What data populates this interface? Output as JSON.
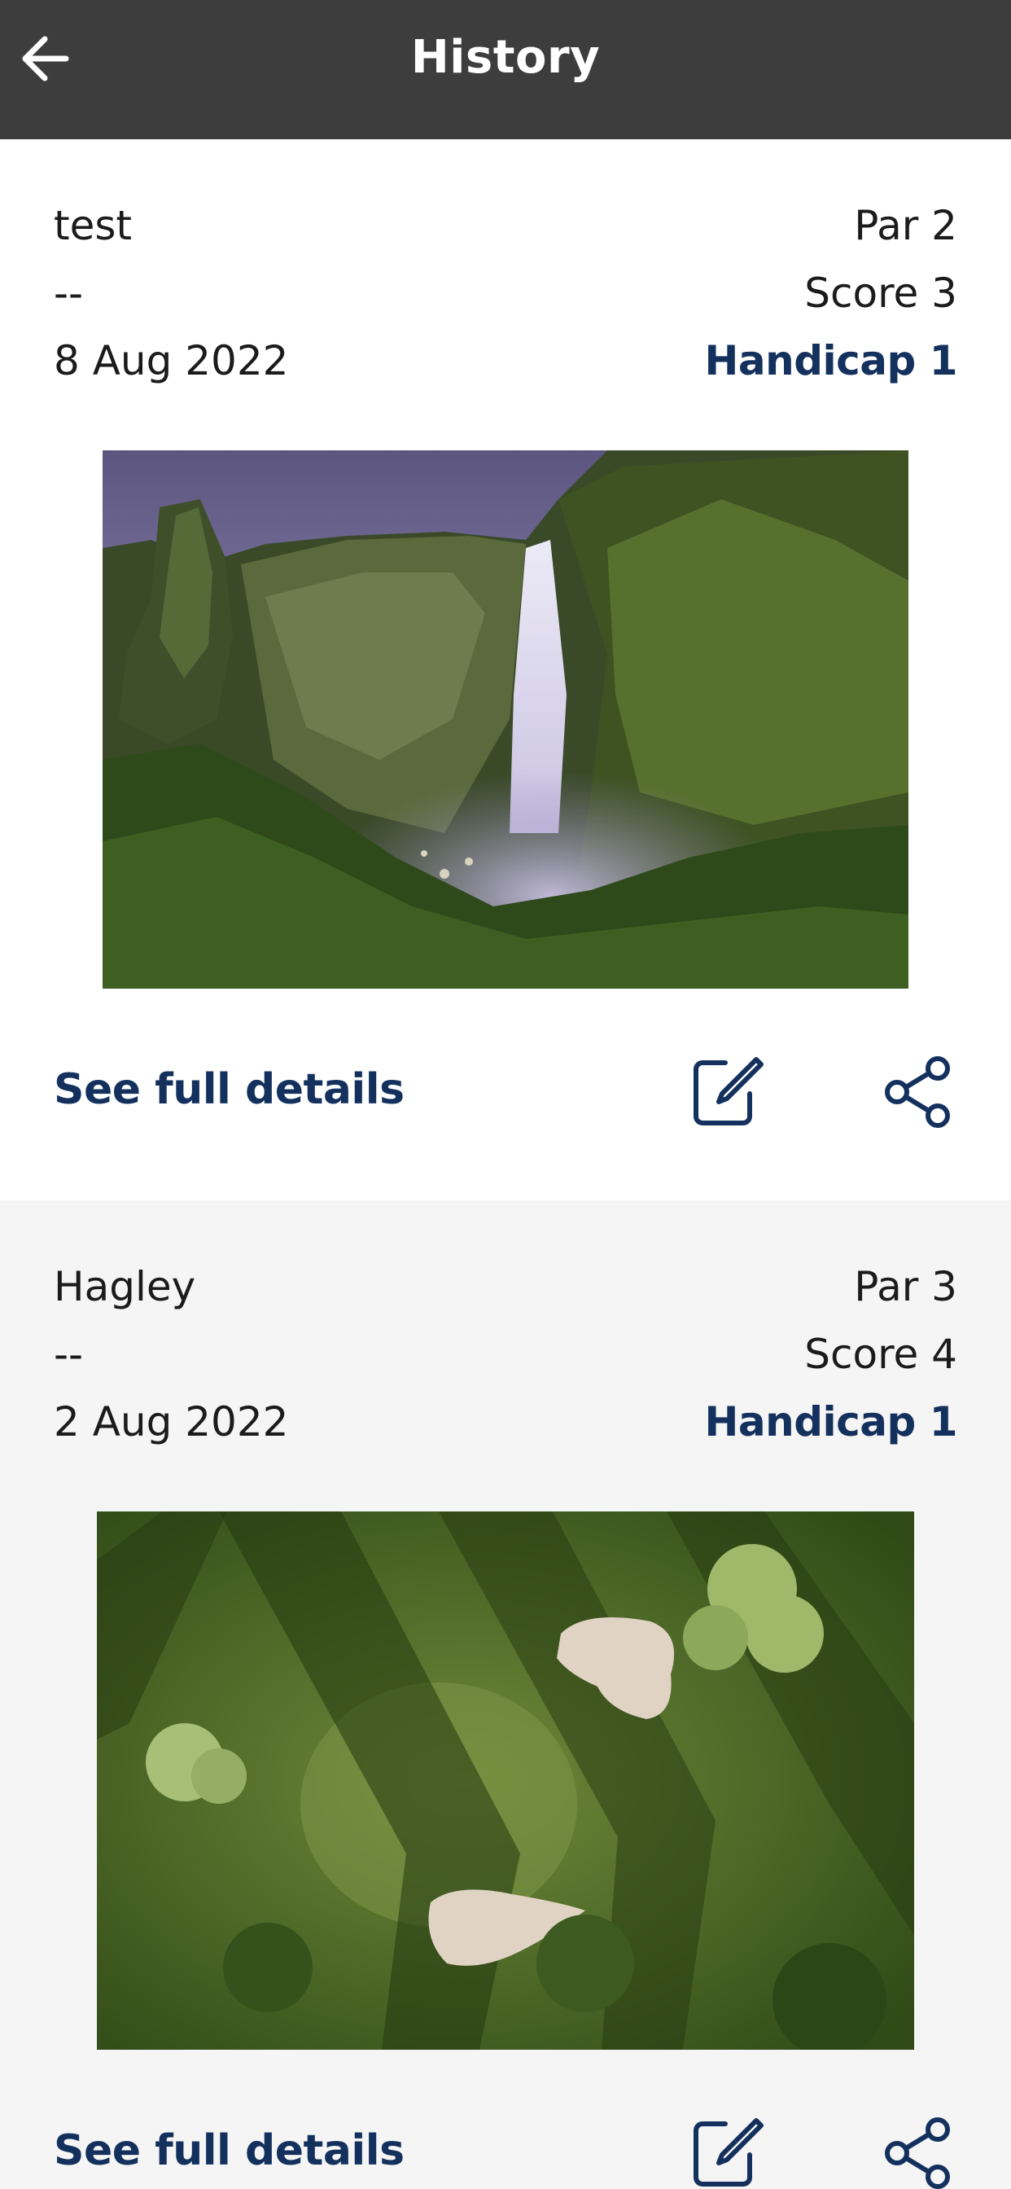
{
  "header": {
    "title": "History",
    "back_icon": "arrow-left-icon"
  },
  "colors": {
    "header_bg": "#3d3d3d",
    "accent": "#14315e",
    "card_bg_primary": "#ffffff",
    "card_bg_alt": "#f5f5f5"
  },
  "rounds": [
    {
      "course": "test",
      "subtitle": "--",
      "date": "8 Aug 2022",
      "par": "Par 2",
      "score": "Score 3",
      "handicap": "Handicap 1",
      "details_label": "See full details",
      "edit_icon": "edit-icon",
      "share_icon": "share-icon"
    },
    {
      "course": "Hagley",
      "subtitle": "--",
      "date": "2 Aug 2022",
      "par": "Par 3",
      "score": "Score 4",
      "handicap": "Handicap 1",
      "details_label": "See full details",
      "edit_icon": "edit-icon",
      "share_icon": "share-icon"
    }
  ]
}
